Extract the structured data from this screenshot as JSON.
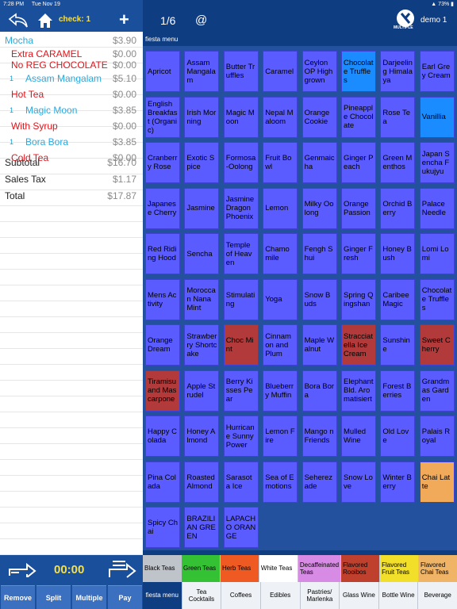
{
  "status": {
    "time": "7:28 PM",
    "date": "Tue Nov 19",
    "battery": "73%"
  },
  "header": {
    "check_label": "check: 1",
    "page": "1/6",
    "at": "@",
    "user": "demo   1",
    "multiple": "MULTIPLE",
    "menu_name": "fiesta menu"
  },
  "order": {
    "items": [
      {
        "qty": "",
        "name": "Mocha",
        "price": "$3.90",
        "color": "blue",
        "indent": 6,
        "tight": false
      },
      {
        "qty": "",
        "name": "Extra CARAMEL",
        "price": "$0.00",
        "color": "red",
        "indent": 14,
        "tight": true
      },
      {
        "qty": "",
        "name": "No REG CHOCOLATE",
        "price": "$0.00",
        "color": "red",
        "indent": 14,
        "tight": true
      },
      {
        "qty": "1",
        "name": "Assam Mangalam",
        "price": "$5.10",
        "color": "blue",
        "indent": 32,
        "tight": false
      },
      {
        "qty": "",
        "name": "Hot Tea",
        "price": "$0.00",
        "color": "red",
        "indent": 14,
        "tight": false
      },
      {
        "qty": "1",
        "name": "Magic Moon",
        "price": "$3.85",
        "color": "blue",
        "indent": 32,
        "tight": false
      },
      {
        "qty": "",
        "name": "With Syrup",
        "price": "$0.00",
        "color": "red",
        "indent": 14,
        "tight": false
      },
      {
        "qty": "1",
        "name": "Bora Bora",
        "price": "$3.85",
        "color": "blue",
        "indent": 32,
        "tight": false
      },
      {
        "qty": "",
        "name": "Cold Tea",
        "price": "$0.00",
        "color": "red",
        "indent": 14,
        "tight": false
      }
    ],
    "subtotal_label": "Subtotal",
    "subtotal": "$16.70",
    "tax_label": "Sales Tax",
    "tax": "$1.17",
    "total_label": "Total",
    "total": "$17.87"
  },
  "timer": "00:00",
  "actions": [
    "Remove",
    "Split",
    "Multiple",
    "Pay"
  ],
  "colors": {
    "tile": "#5b5cff",
    "tile_selected": "#1a8cff",
    "tile_red": "#b23a3a",
    "tile_orange": "#f0aa5a"
  },
  "tiles": [
    [
      "Apricot",
      "Assam Mangalam",
      "Butter Truffles",
      "Caramel",
      "Ceylon OP Highgrown",
      "Chocolate Truffles",
      "Darjeeling Himalaya",
      "Earl Grey Cream"
    ],
    [
      "English Breakfast (Organic)",
      "Irish Morning",
      "Magic Moon",
      "Nepal Maloom",
      "Orange Cookie",
      "Pineapple Chocolate",
      "Rose Tea",
      "Vanillia"
    ],
    [
      "Cranberry Rose",
      "Exotic Spice",
      "Formosa-Oolong",
      "Fruit Bowl",
      "Genmaicha",
      "Ginger Peach",
      "Green Menthos",
      "Japan Sencha Fukujyu"
    ],
    [
      "Japanese Cherry",
      "Jasmine",
      "Jasmine Dragon Phoenix",
      "Lemon",
      "Milky Oolong",
      "Orange Passion",
      "Orchid Berry",
      "Palace Needle"
    ],
    [
      "Red Riding Hood",
      "Sencha",
      "Temple of Heaven",
      "Chamomile",
      "Fengh Shui",
      "Ginger Fresh",
      "Honey Bush",
      "Lomi Lomi"
    ],
    [
      "Mens Activity",
      "Moroccan Nana Mint",
      "Stimulating",
      "Yoga",
      "Snow Buds",
      "Spring Qingshan",
      "Caribee Magic",
      "Chocolate Truffles"
    ],
    [
      "Orange Dream",
      "Strawberry Shortcake",
      "Choc Mint",
      "Cinnamon and Plum",
      "Maple Walnut",
      "Stracciatella Ice Cream",
      "Sunshine",
      "Sweet Cherry"
    ],
    [
      "Tiramisu and Mascarpone",
      "Apple Strudel",
      "Berry Kisses Pear",
      "Blueberry Muffin",
      "Bora Bora",
      "Elephant Bld. Aromatisiert",
      "Forest Berries",
      "Grandmas Garden"
    ],
    [
      "Happy Colada",
      "Honey Almond",
      "Hurricane Sunny Power",
      "Lemon Fire",
      "Mango n Friends",
      "Mulled Wine",
      "Old Love",
      "Palais Royal"
    ],
    [
      "Pina Colada",
      "Roasted Almond",
      "Sarasota Ice",
      "Sea of Emotions",
      "Seherezade",
      "Snow Love",
      "Winter Berry",
      "Chai Latte"
    ],
    [
      "Spicy Chai",
      "BRAZILIAN GREEN",
      "LAPACHO ORANGE"
    ]
  ],
  "tile_special": {
    "0-5": "tile_selected",
    "1-7": "tile_selected",
    "6-2": "tile_red",
    "6-5": "tile_red",
    "6-7": "tile_red",
    "7-0": "tile_red",
    "9-7": "tile_orange"
  },
  "categories": [
    {
      "label": "Black Teas",
      "bg": "#bfc3ca"
    },
    {
      "label": "Green Teas",
      "bg": "#34c234"
    },
    {
      "label": "Herb Teas",
      "bg": "#ef5a22"
    },
    {
      "label": "White Teas",
      "bg": "#ffffff"
    },
    {
      "label": "Decaffeinated Teas",
      "bg": "#d88be4"
    },
    {
      "label": "Flavored Rooibos",
      "bg": "#c0402e"
    },
    {
      "label": "Flavored Fruit Teas",
      "bg": "#f2df2a"
    },
    {
      "label": "Flavored Chai Teas",
      "bg": "#f0b466"
    }
  ],
  "tabs": [
    "fiesta menu",
    "Tea Cocktails",
    "Coffees",
    "Edibles",
    "Pastries/ Marlenka",
    "Glass Wine",
    "Bottle Wine",
    "Beverage"
  ]
}
